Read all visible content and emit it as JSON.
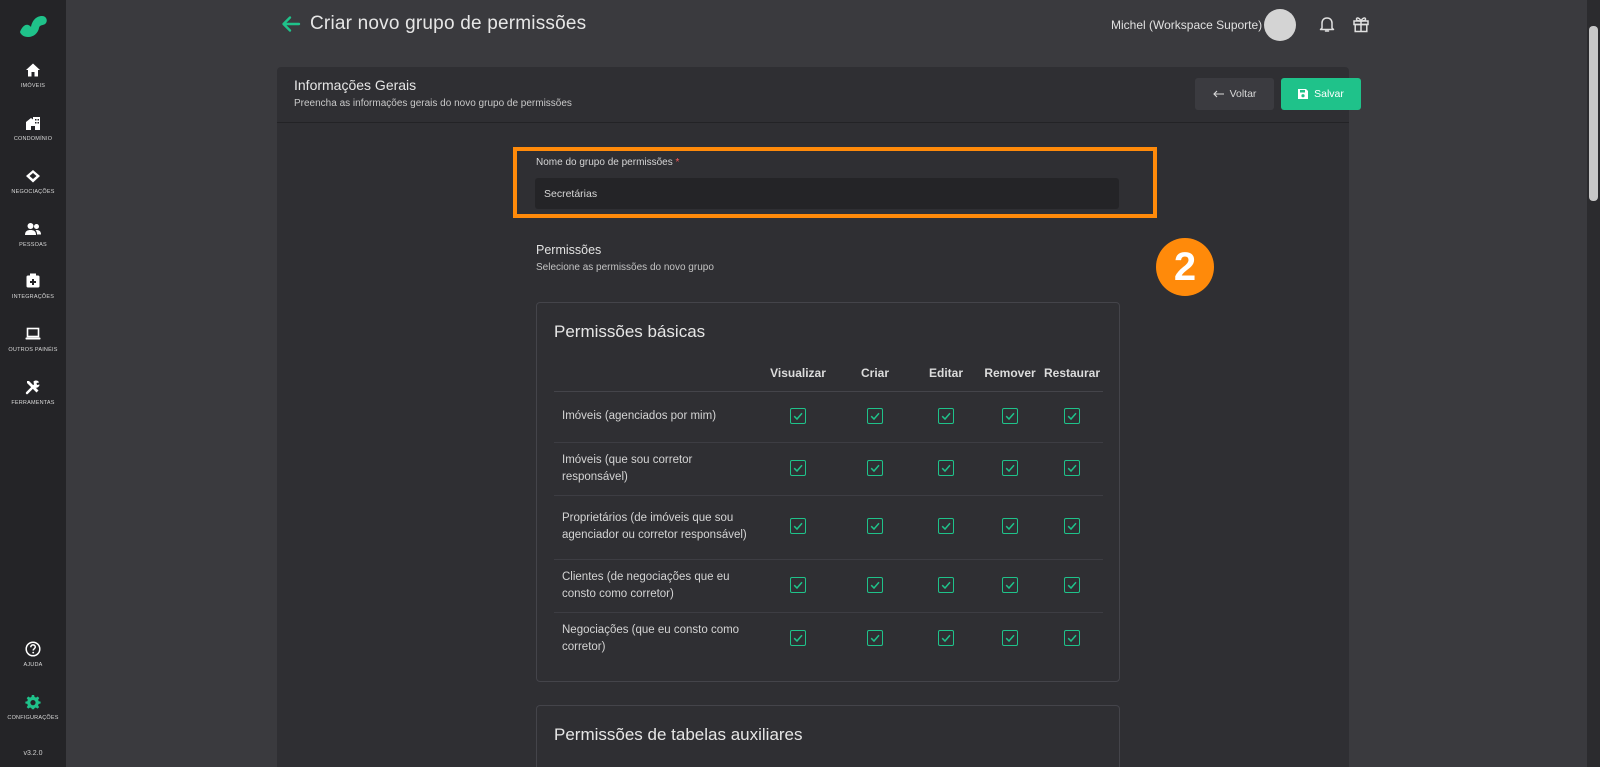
{
  "sidebar": {
    "items": [
      {
        "label": "Imóveis",
        "icon": "home-icon"
      },
      {
        "label": "Condomínio",
        "icon": "building-icon"
      },
      {
        "label": "Negociações",
        "icon": "handshake-icon"
      },
      {
        "label": "Pessoas",
        "icon": "people-icon"
      },
      {
        "label": "Integrações",
        "icon": "integration-icon"
      },
      {
        "label": "Outros painéis",
        "icon": "laptop-icon"
      },
      {
        "label": "Ferramentas",
        "icon": "tools-icon"
      }
    ],
    "help_label": "Ajuda",
    "settings_label": "Configurações",
    "version": "v3.2.0"
  },
  "header": {
    "title": "Criar novo grupo de permissões",
    "user": "Michel (Workspace Suporte)"
  },
  "card": {
    "title": "Informações Gerais",
    "subtitle": "Preencha as informações gerais do novo grupo de permissões",
    "back_label": "Voltar",
    "save_label": "Salvar"
  },
  "form": {
    "name_label": "Nome do grupo de permissões",
    "required_mark": "*",
    "name_value": "Secretárias"
  },
  "step_badge": "2",
  "permissions": {
    "title": "Permissões",
    "subtitle": "Selecione as permissões do novo grupo",
    "basic": {
      "title": "Permissões básicas",
      "columns": [
        "Visualizar",
        "Criar",
        "Editar",
        "Remover",
        "Restaurar"
      ],
      "rows": [
        {
          "label": "Imóveis (agenciados por mim)",
          "checked": [
            true,
            true,
            true,
            true,
            true
          ]
        },
        {
          "label": "Imóveis (que sou corretor responsável)",
          "checked": [
            true,
            true,
            true,
            true,
            true
          ]
        },
        {
          "label": "Proprietários (de imóveis que sou agenciador ou corretor responsável)",
          "checked": [
            true,
            true,
            true,
            true,
            true
          ]
        },
        {
          "label": "Clientes (de negociações que eu consto como corretor)",
          "checked": [
            true,
            true,
            true,
            true,
            true
          ]
        },
        {
          "label": "Negociações (que eu consto como corretor)",
          "checked": [
            true,
            true,
            true,
            true,
            true
          ]
        }
      ]
    },
    "aux_title": "Permissões de tabelas auxiliares"
  },
  "colors": {
    "accent": "#1fc28a",
    "highlight": "#ff8a0a",
    "background": "#3a3a3e",
    "sidebar": "#242427"
  }
}
